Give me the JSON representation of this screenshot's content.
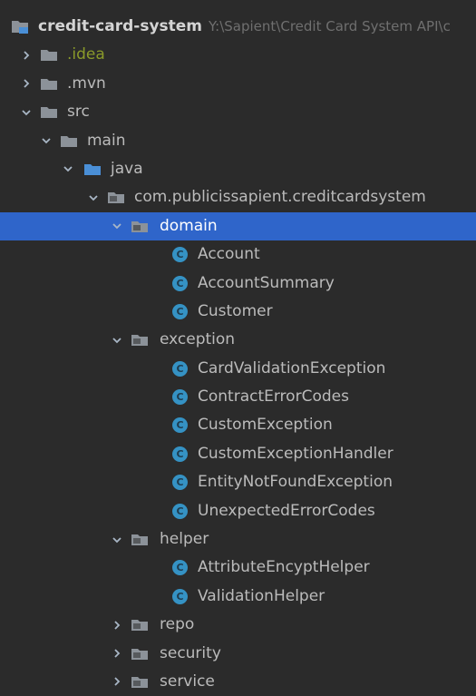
{
  "project": {
    "name": "credit-card-system",
    "path": "Y:\\Sapient\\Credit Card System API\\c"
  },
  "tree": [
    {
      "label": "credit-card-system",
      "depth": 0,
      "type": "project",
      "expanded": true
    },
    {
      "label": ".idea",
      "depth": 0,
      "type": "folder",
      "expanded": false
    },
    {
      "label": ".mvn",
      "depth": 0,
      "type": "folder",
      "expanded": false
    },
    {
      "label": "src",
      "depth": 0,
      "type": "folder",
      "expanded": true
    },
    {
      "label": "main",
      "depth": 1,
      "type": "folder",
      "expanded": true
    },
    {
      "label": "java",
      "depth": 2,
      "type": "source-folder",
      "expanded": true
    },
    {
      "label": "com.publicissapient.creditcardsystem",
      "depth": 3,
      "type": "package",
      "expanded": true
    },
    {
      "label": "domain",
      "depth": 4,
      "type": "package",
      "expanded": true,
      "selected": true
    },
    {
      "label": "Account",
      "depth": 5,
      "type": "class"
    },
    {
      "label": "AccountSummary",
      "depth": 5,
      "type": "class"
    },
    {
      "label": "Customer",
      "depth": 5,
      "type": "class"
    },
    {
      "label": "exception",
      "depth": 4,
      "type": "package",
      "expanded": true
    },
    {
      "label": "CardValidationException",
      "depth": 5,
      "type": "class"
    },
    {
      "label": "ContractErrorCodes",
      "depth": 5,
      "type": "class"
    },
    {
      "label": "CustomException",
      "depth": 5,
      "type": "class"
    },
    {
      "label": "CustomExceptionHandler",
      "depth": 5,
      "type": "class"
    },
    {
      "label": "EntityNotFoundException",
      "depth": 5,
      "type": "class"
    },
    {
      "label": "UnexpectedErrorCodes",
      "depth": 5,
      "type": "class"
    },
    {
      "label": "helper",
      "depth": 4,
      "type": "package",
      "expanded": true
    },
    {
      "label": "AttributeEncyptHelper",
      "depth": 5,
      "type": "class"
    },
    {
      "label": "ValidationHelper",
      "depth": 5,
      "type": "class"
    },
    {
      "label": "repo",
      "depth": 4,
      "type": "package",
      "expanded": false
    },
    {
      "label": "security",
      "depth": 4,
      "type": "package",
      "expanded": false
    },
    {
      "label": "service",
      "depth": 4,
      "type": "package",
      "expanded": false
    }
  ],
  "icons": {
    "folder": "folder-icon",
    "source-folder": "source-folder-icon",
    "package": "package-icon",
    "class": "class-icon",
    "project": "project-icon",
    "class_letter": "C"
  },
  "colors": {
    "background": "#2b2b2b",
    "selection": "#2f65ca",
    "class_icon": "#3592c4",
    "folder": "#8c9299",
    "source_folder": "#4a8fd6",
    "excluded_folder": "#8a9a2a"
  }
}
